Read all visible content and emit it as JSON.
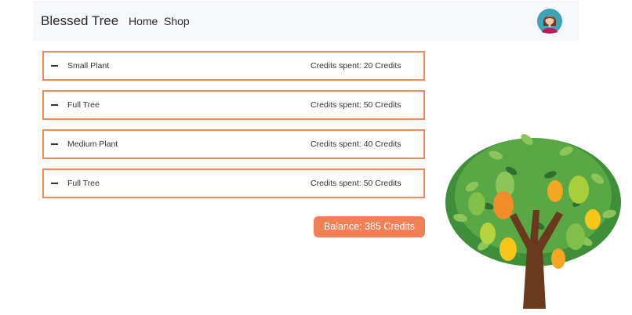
{
  "navbar": {
    "brand": "Blessed Tree",
    "links": [
      {
        "label": "Home"
      },
      {
        "label": "Shop"
      }
    ],
    "avatar_icon": "user-avatar-icon"
  },
  "purchases": [
    {
      "name": "Small Plant",
      "credits": "Credits spent: 20 Credits"
    },
    {
      "name": "Full Tree",
      "credits": "Credits spent: 50 Credits"
    },
    {
      "name": "Medium Plant",
      "credits": "Credits spent: 40 Credits"
    },
    {
      "name": "Full Tree",
      "credits": "Credits spent: 50 Credits"
    }
  ],
  "balance": {
    "label": "Balance: 385 Credits"
  },
  "colors": {
    "accent": "#f37f54",
    "row_border": "#f08a5d",
    "navbar_bg": "#f7f8fa"
  }
}
